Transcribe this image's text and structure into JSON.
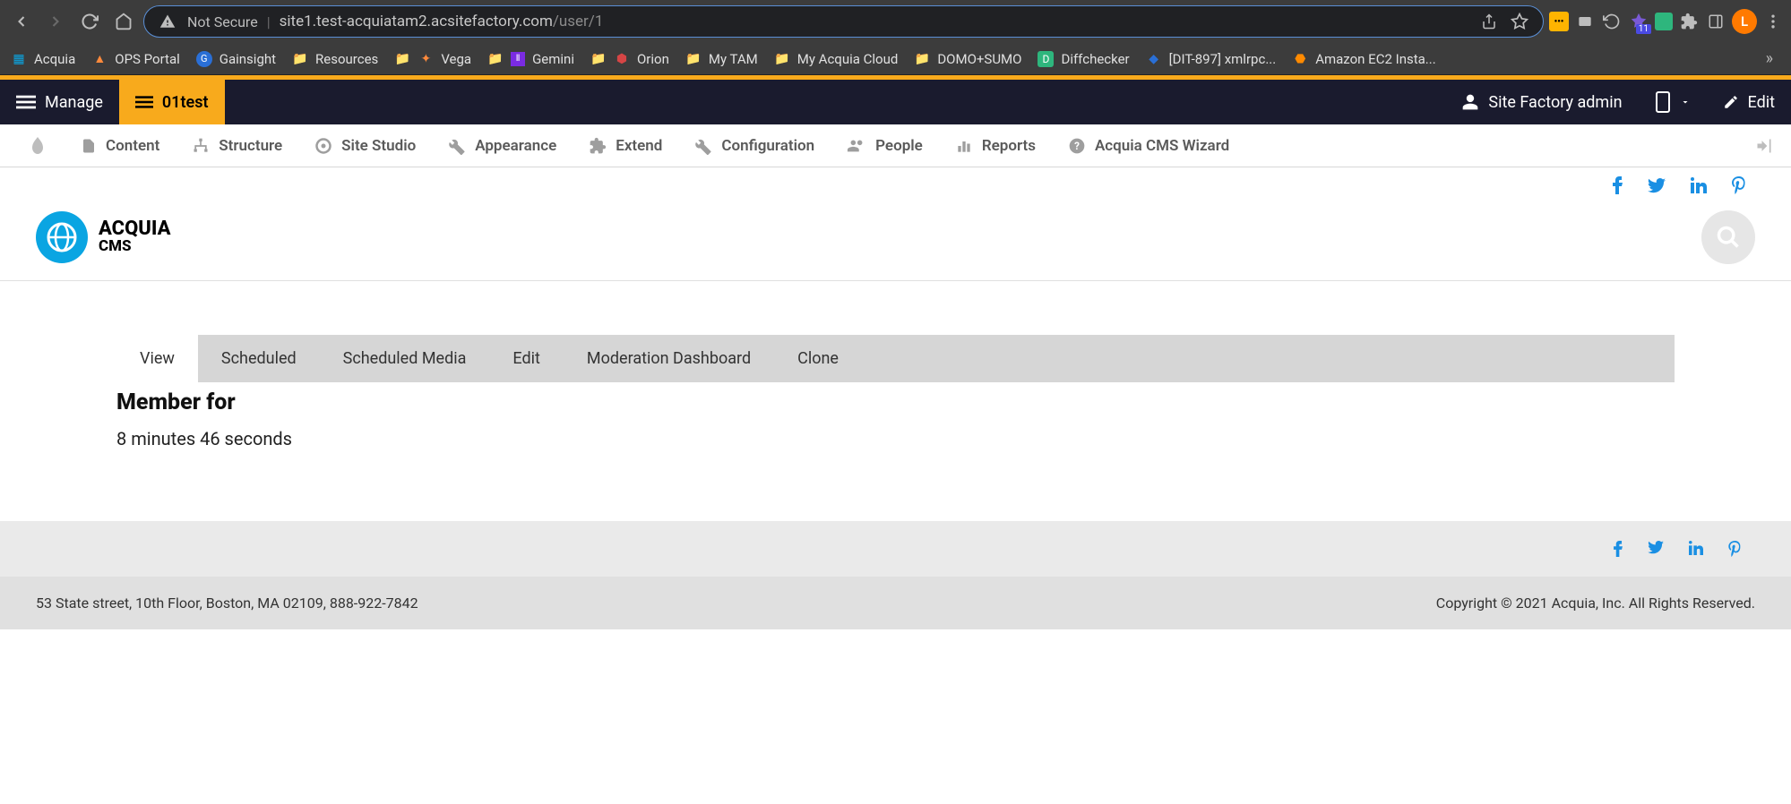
{
  "browser": {
    "security_label": "Not Secure",
    "url_host": "site1.test-acquiatam2.acsitefactory.com",
    "url_path": "/user/1",
    "avatar_initial": "L",
    "extension_badge": "11"
  },
  "bookmarks": [
    {
      "label": "Acquia"
    },
    {
      "label": "OPS Portal"
    },
    {
      "label": "Gainsight"
    },
    {
      "label": "Resources"
    },
    {
      "label": "Vega"
    },
    {
      "label": "Gemini"
    },
    {
      "label": "Orion"
    },
    {
      "label": "My TAM"
    },
    {
      "label": "My Acquia Cloud"
    },
    {
      "label": "DOMO+SUMO"
    },
    {
      "label": "Diffchecker"
    },
    {
      "label": "[DIT-897] xmlrpc..."
    },
    {
      "label": "Amazon EC2 Insta..."
    }
  ],
  "topbar": {
    "manage": "Manage",
    "site_name": "01test",
    "user": "Site Factory admin",
    "edit": "Edit"
  },
  "admin_menu": [
    {
      "label": "Content"
    },
    {
      "label": "Structure"
    },
    {
      "label": "Site Studio"
    },
    {
      "label": "Appearance"
    },
    {
      "label": "Extend"
    },
    {
      "label": "Configuration"
    },
    {
      "label": "People"
    },
    {
      "label": "Reports"
    },
    {
      "label": "Acquia CMS Wizard"
    }
  ],
  "logo": {
    "line1": "ACQUIA",
    "line2": "CMS"
  },
  "tabs": [
    {
      "label": "View",
      "active": true
    },
    {
      "label": "Scheduled"
    },
    {
      "label": "Scheduled Media"
    },
    {
      "label": "Edit"
    },
    {
      "label": "Moderation Dashboard"
    },
    {
      "label": "Clone"
    }
  ],
  "profile": {
    "member_for_label": "Member for",
    "member_for_value": "8 minutes 46 seconds"
  },
  "footer": {
    "address": "53 State street, 10th Floor, Boston, MA 02109, 888-922-7842",
    "copyright": "Copyright © 2021 Acquia, Inc. All Rights Reserved."
  }
}
